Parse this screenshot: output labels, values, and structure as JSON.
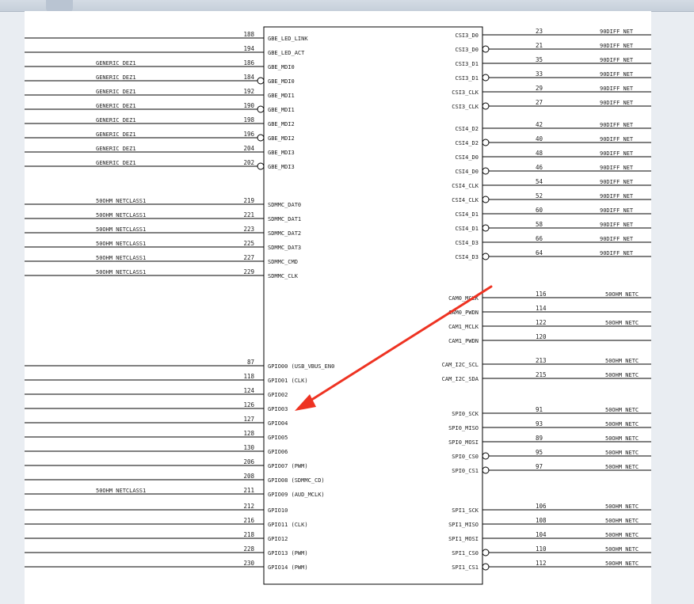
{
  "left_pins": [
    {
      "num": "188",
      "name": "GBE_LED_LINK",
      "net": "",
      "inv": false
    },
    {
      "num": "194",
      "name": "GBE_LED_ACT",
      "net": "",
      "inv": false
    },
    {
      "num": "186",
      "name": "GBE_MDI0",
      "net": "GENERIC_DEZ1",
      "inv": false
    },
    {
      "num": "184",
      "name": "GBE_MDI0",
      "net": "GENERIC_DEZ1",
      "inv": true
    },
    {
      "num": "192",
      "name": "GBE_MDI1",
      "net": "GENERIC_DEZ1",
      "inv": false
    },
    {
      "num": "190",
      "name": "GBE_MDI1",
      "net": "GENERIC_DEZ1",
      "inv": true
    },
    {
      "num": "198",
      "name": "GBE_MDI2",
      "net": "GENERIC_DEZ1",
      "inv": false
    },
    {
      "num": "196",
      "name": "GBE_MDI2",
      "net": "GENERIC_DEZ1",
      "inv": true
    },
    {
      "num": "204",
      "name": "GBE_MDI3",
      "net": "GENERIC_DEZ1",
      "inv": false
    },
    {
      "num": "202",
      "name": "GBE_MDI3",
      "net": "GENERIC_DEZ1",
      "inv": true
    },
    {
      "num": "219",
      "name": "SDMMC_DAT0",
      "net": "50OHM_NETCLASS1",
      "inv": false
    },
    {
      "num": "221",
      "name": "SDMMC_DAT1",
      "net": "50OHM_NETCLASS1",
      "inv": false
    },
    {
      "num": "223",
      "name": "SDMMC_DAT2",
      "net": "50OHM_NETCLASS1",
      "inv": false
    },
    {
      "num": "225",
      "name": "SDMMC_DAT3",
      "net": "50OHM_NETCLASS1",
      "inv": false
    },
    {
      "num": "227",
      "name": "SDMMC_CMD",
      "net": "50OHM_NETCLASS1",
      "inv": false
    },
    {
      "num": "229",
      "name": "SDMMC_CLK",
      "net": "50OHM_NETCLASS1",
      "inv": false
    },
    {
      "num": "87",
      "name": "GPIO00 (USB_VBUS_EN0",
      "net": "",
      "inv": false
    },
    {
      "num": "118",
      "name": "GPIO01 (CLK)",
      "net": "",
      "inv": false
    },
    {
      "num": "124",
      "name": "GPIO02",
      "net": "",
      "inv": false
    },
    {
      "num": "126",
      "name": "GPIO03",
      "net": "",
      "inv": false
    },
    {
      "num": "127",
      "name": "GPIO04",
      "net": "",
      "inv": false
    },
    {
      "num": "128",
      "name": "GPIO05",
      "net": "",
      "inv": false
    },
    {
      "num": "130",
      "name": "GPIO06",
      "net": "",
      "inv": false
    },
    {
      "num": "206",
      "name": "GPIO07 (PWM)",
      "net": "",
      "inv": false
    },
    {
      "num": "208",
      "name": "GPIO08 (SDMMC_CD)",
      "net": "",
      "inv": false
    },
    {
      "num": "211",
      "name": "GPIO09 (AUD_MCLK)",
      "net": "50OHM_NETCLASS1",
      "inv": false
    },
    {
      "num": "212",
      "name": "GPIO10",
      "net": "",
      "inv": false
    },
    {
      "num": "216",
      "name": "GPIO11 (CLK)",
      "net": "",
      "inv": false
    },
    {
      "num": "218",
      "name": "GPIO12",
      "net": "",
      "inv": false
    },
    {
      "num": "228",
      "name": "GPIO13 (PWM)",
      "net": "",
      "inv": false
    },
    {
      "num": "230",
      "name": "GPIO14 (PWM)",
      "net": "",
      "inv": false
    }
  ],
  "right_pins": [
    {
      "num": "23",
      "name": "CSI3_D0",
      "net": "90DIFF_NET",
      "inv": false
    },
    {
      "num": "21",
      "name": "CSI3_D0",
      "net": "90DIFF_NET",
      "inv": true
    },
    {
      "num": "35",
      "name": "CSI3_D1",
      "net": "90DIFF_NET",
      "inv": false
    },
    {
      "num": "33",
      "name": "CSI3_D1",
      "net": "90DIFF_NET",
      "inv": true
    },
    {
      "num": "29",
      "name": "CSI3_CLK",
      "net": "90DIFF_NET",
      "inv": false
    },
    {
      "num": "27",
      "name": "CSI3_CLK",
      "net": "90DIFF_NET",
      "inv": true
    },
    {
      "num": "42",
      "name": "CSI4_D2",
      "net": "90DIFF_NET",
      "inv": false
    },
    {
      "num": "40",
      "name": "CSI4_D2",
      "net": "90DIFF_NET",
      "inv": true
    },
    {
      "num": "48",
      "name": "CSI4_D0",
      "net": "90DIFF_NET",
      "inv": false
    },
    {
      "num": "46",
      "name": "CSI4_D0",
      "net": "90DIFF_NET",
      "inv": true
    },
    {
      "num": "54",
      "name": "CSI4_CLK",
      "net": "90DIFF_NET",
      "inv": false
    },
    {
      "num": "52",
      "name": "CSI4_CLK",
      "net": "90DIFF_NET",
      "inv": true
    },
    {
      "num": "60",
      "name": "CSI4_D1",
      "net": "90DIFF_NET",
      "inv": false
    },
    {
      "num": "58",
      "name": "CSI4_D1",
      "net": "90DIFF_NET",
      "inv": true
    },
    {
      "num": "66",
      "name": "CSI4_D3",
      "net": "90DIFF_NET",
      "inv": false
    },
    {
      "num": "64",
      "name": "CSI4_D3",
      "net": "90DIFF_NET",
      "inv": true
    },
    {
      "num": "116",
      "name": "CAM0_MCLK",
      "net": "50OHM_NETC",
      "inv": false
    },
    {
      "num": "114",
      "name": "CAM0_PWDN",
      "net": "",
      "inv": false
    },
    {
      "num": "122",
      "name": "CAM1_MCLK",
      "net": "50OHM_NETC",
      "inv": false
    },
    {
      "num": "120",
      "name": "CAM1_PWDN",
      "net": "",
      "inv": false
    },
    {
      "num": "213",
      "name": "CAM_I2C_SCL",
      "net": "50OHM_NETC",
      "inv": false
    },
    {
      "num": "215",
      "name": "CAM_I2C_SDA",
      "net": "50OHM_NETC",
      "inv": false
    },
    {
      "num": "91",
      "name": "SPI0_SCK",
      "net": "50OHM_NETC",
      "inv": false
    },
    {
      "num": "93",
      "name": "SPI0_MISO",
      "net": "50OHM_NETC",
      "inv": false
    },
    {
      "num": "89",
      "name": "SPI0_MOSI",
      "net": "50OHM_NETC",
      "inv": false
    },
    {
      "num": "95",
      "name": "SPI0_CS0",
      "net": "50OHM_NETC",
      "inv": true
    },
    {
      "num": "97",
      "name": "SPI0_CS1",
      "net": "50OHM_NETC",
      "inv": true
    },
    {
      "num": "106",
      "name": "SPI1_SCK",
      "net": "50OHM_NETC",
      "inv": false
    },
    {
      "num": "108",
      "name": "SPI1_MISO",
      "net": "50OHM_NETC",
      "inv": false
    },
    {
      "num": "104",
      "name": "SPI1_MOSI",
      "net": "50OHM_NETC",
      "inv": false
    },
    {
      "num": "110",
      "name": "SPI1_CS0",
      "net": "50OHM_NETC",
      "inv": true
    },
    {
      "num": "112",
      "name": "SPI1_CS1",
      "net": "50OHM_NETC",
      "inv": true
    }
  ],
  "colors": {
    "line": "#000000",
    "arrow": "#ee3322",
    "text": "#222222"
  }
}
